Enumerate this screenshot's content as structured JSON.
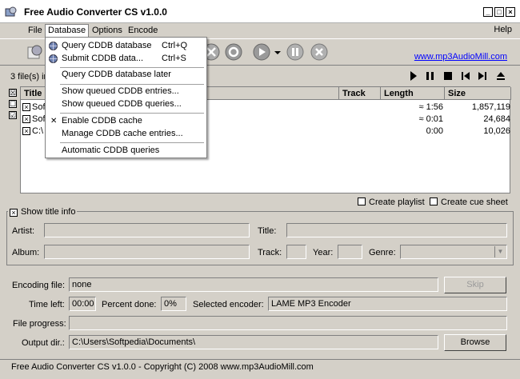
{
  "window": {
    "title": "Free Audio Converter CS v1.0.0",
    "min": "_",
    "max": "□",
    "close": "×"
  },
  "menu": {
    "file": "File",
    "database": "Database",
    "options": "Options",
    "encode": "Encode",
    "help": "Help"
  },
  "toolbar": {
    "link": "www.mp3AudioMill.com"
  },
  "files_info": "3 file(s) in",
  "columns": {
    "title": "Title",
    "track": "Track",
    "length": "Length",
    "size": "Size"
  },
  "files": [
    {
      "title": "Sof",
      "length": "≈ 1:56",
      "size": "1,857,119"
    },
    {
      "title": "Sof",
      "length": "≈ 0:01",
      "size": "24,684"
    },
    {
      "title": "C:\\",
      "length": "0:00",
      "size": "10,026"
    }
  ],
  "left_checks": [
    "☒",
    "☐",
    "☑"
  ],
  "options": {
    "playlist": "Create playlist",
    "cuesheet": "Create cue sheet"
  },
  "title_info": {
    "header": "Show title info",
    "artist": "Artist:",
    "title": "Title:",
    "album": "Album:",
    "track": "Track:",
    "year": "Year:",
    "genre": "Genre:"
  },
  "encoding": {
    "file_label": "Encoding file:",
    "file_value": "none",
    "skip": "Skip",
    "time_left_label": "Time left:",
    "time_left_value": "00:00",
    "percent_label": "Percent done:",
    "percent_value": "0%",
    "encoder_label": "Selected encoder:",
    "encoder_value": "LAME MP3 Encoder",
    "progress_label": "File progress:",
    "output_label": "Output dir.:",
    "output_value": "C:\\Users\\Softpedia\\Documents\\",
    "browse": "Browse"
  },
  "status": "Free Audio Converter CS v1.0.0 - Copyright (C) 2008 www.mp3AudioMill.com",
  "database_menu": [
    {
      "label": "Query CDDB database",
      "shortcut": "Ctrl+Q",
      "icon": "globe-icon"
    },
    {
      "label": "Submit CDDB data...",
      "shortcut": "Ctrl+S",
      "icon": "globe-icon"
    },
    {
      "label": "Query CDDB database later"
    },
    {
      "label": "Show queued CDDB entries..."
    },
    {
      "label": "Show queued CDDB queries..."
    },
    {
      "label": "Enable CDDB cache",
      "checked": true
    },
    {
      "label": "Manage CDDB cache entries..."
    },
    {
      "label": "Automatic CDDB queries"
    }
  ]
}
